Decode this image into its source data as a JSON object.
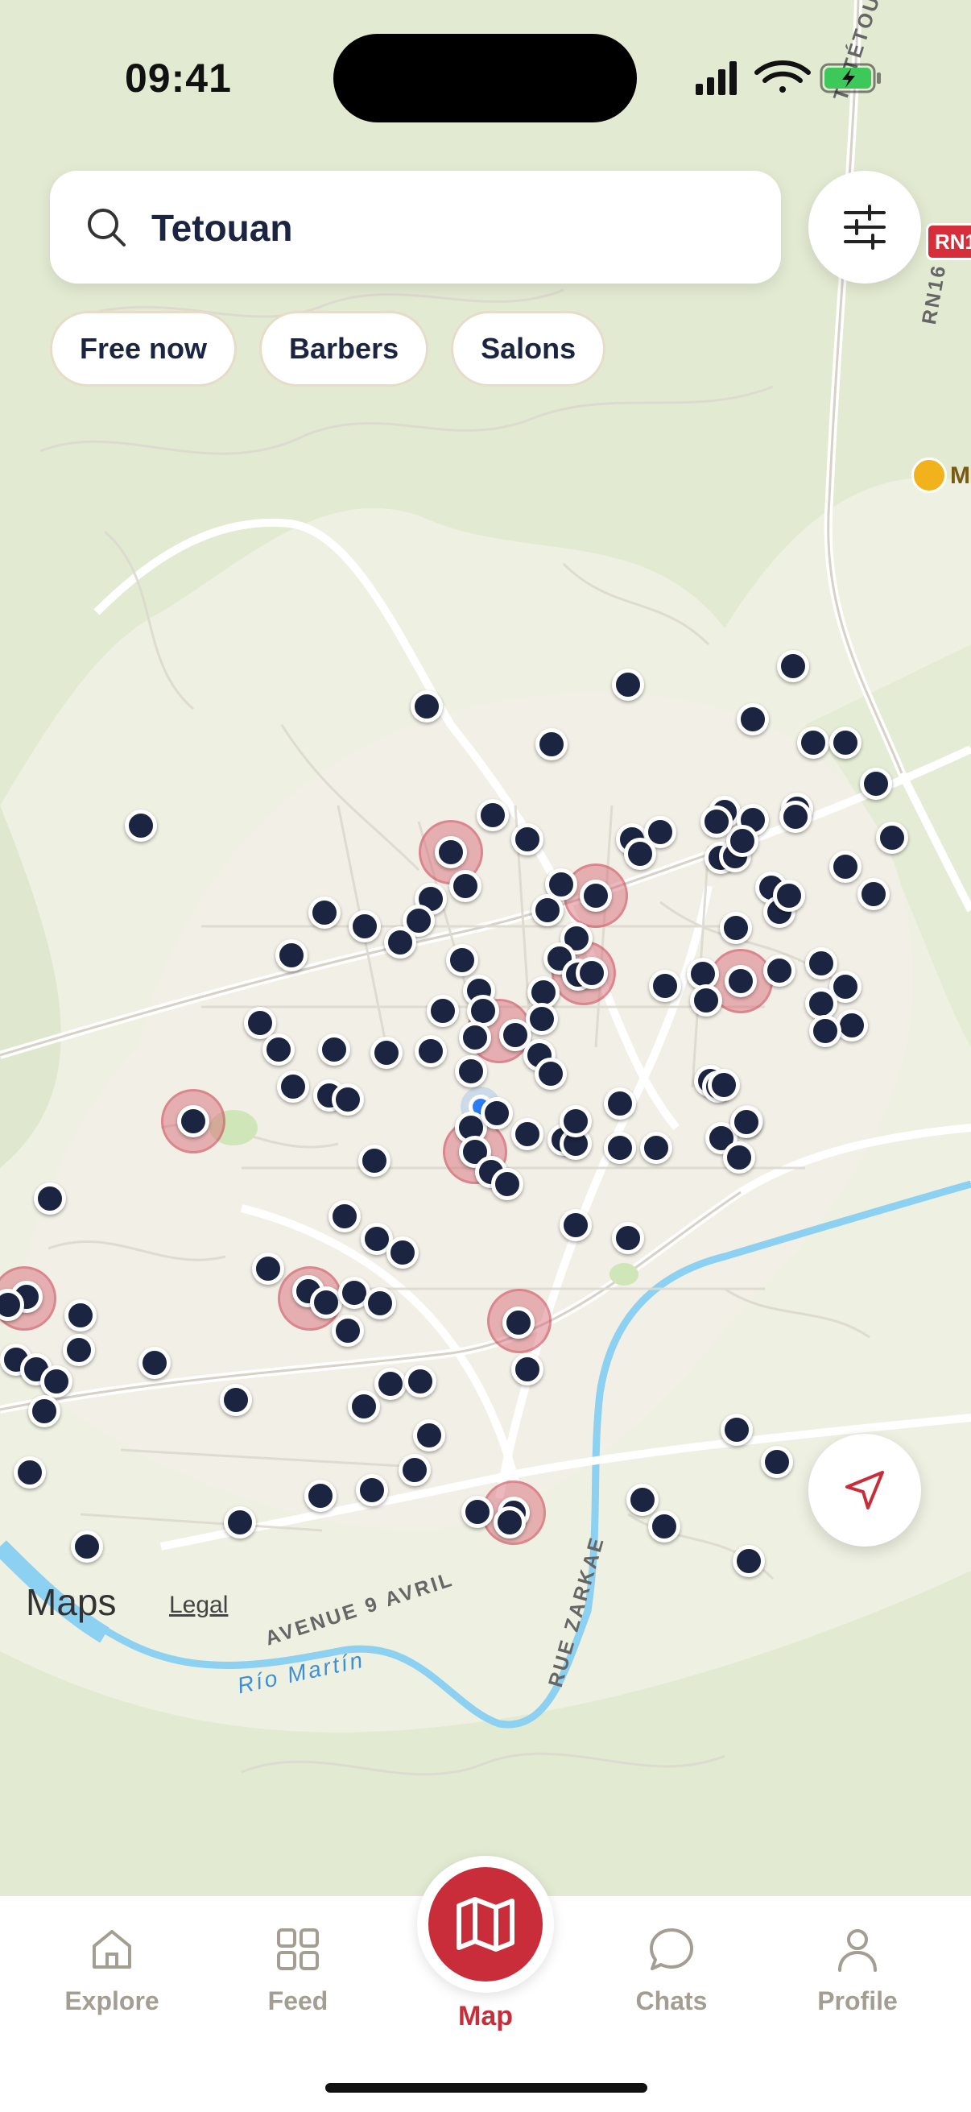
{
  "status_bar": {
    "time": "09:41"
  },
  "search": {
    "query": "Tetouan"
  },
  "filter_chips": [
    "Free now",
    "Barbers",
    "Salons"
  ],
  "map": {
    "attribution": "Maps",
    "legal": "Legal",
    "streets": [
      "AVENUE 9 AVRIL",
      "RUE ZARKAE",
      "RN16",
      "TETÉTOUAN-F"
    ],
    "river": "Río Martín",
    "road_badge": "RN1",
    "poi_label": "M",
    "pin_count_shown": 150
  },
  "tabs": [
    {
      "label": "Explore",
      "icon": "home-icon",
      "active": false
    },
    {
      "label": "Feed",
      "icon": "grid-icon",
      "active": false
    },
    {
      "label": "Map",
      "icon": "map-icon",
      "active": true
    },
    {
      "label": "Chats",
      "icon": "chat-icon",
      "active": false
    },
    {
      "label": "Profile",
      "icon": "person-icon",
      "active": false
    }
  ],
  "colors": {
    "accent": "#c92d3a",
    "pin": "#1b2440",
    "water": "#7cc8ef",
    "land": "#eef0e2"
  }
}
